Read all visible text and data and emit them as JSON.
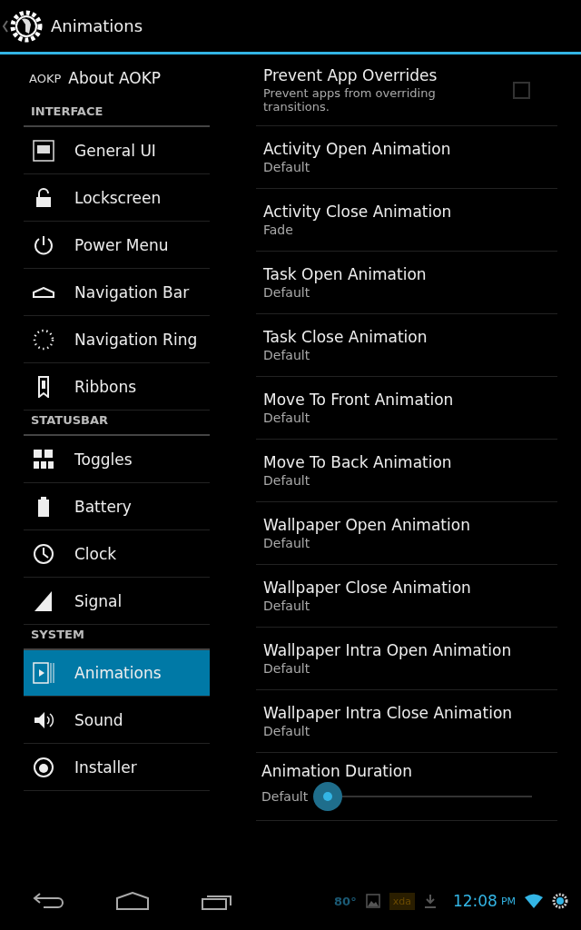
{
  "action_bar": {
    "title": "Animations"
  },
  "sidebar": [
    {
      "kind": "item",
      "logo": "AOKP",
      "label": "About AOKP",
      "selected": false
    },
    {
      "kind": "header",
      "label": "INTERFACE"
    },
    {
      "kind": "item",
      "label": "General UI",
      "selected": false
    },
    {
      "kind": "item",
      "label": "Lockscreen",
      "selected": false
    },
    {
      "kind": "item",
      "label": "Power Menu",
      "selected": false
    },
    {
      "kind": "item",
      "label": "Navigation Bar",
      "selected": false
    },
    {
      "kind": "item",
      "label": "Navigation Ring",
      "selected": false
    },
    {
      "kind": "item",
      "label": "Ribbons",
      "selected": false
    },
    {
      "kind": "header",
      "label": "STATUSBAR"
    },
    {
      "kind": "item",
      "label": "Toggles",
      "selected": false
    },
    {
      "kind": "item",
      "label": "Battery",
      "selected": false
    },
    {
      "kind": "item",
      "label": "Clock",
      "selected": false
    },
    {
      "kind": "item",
      "label": "Signal",
      "selected": false
    },
    {
      "kind": "header",
      "label": "SYSTEM"
    },
    {
      "kind": "item",
      "label": "Animations",
      "selected": true
    },
    {
      "kind": "item",
      "label": "Sound",
      "selected": false
    },
    {
      "kind": "item",
      "label": "Installer",
      "selected": false
    }
  ],
  "settings": [
    {
      "kind": "checkbox",
      "title": "Prevent App Overrides",
      "summary": "Prevent apps from overriding transitions.",
      "checked": false
    },
    {
      "kind": "choice",
      "title": "Activity Open Animation",
      "summary": "Default"
    },
    {
      "kind": "choice",
      "title": "Activity Close Animation",
      "summary": "Fade"
    },
    {
      "kind": "choice",
      "title": "Task Open Animation",
      "summary": "Default"
    },
    {
      "kind": "choice",
      "title": "Task Close Animation",
      "summary": "Default"
    },
    {
      "kind": "choice",
      "title": "Move To Front Animation",
      "summary": "Default"
    },
    {
      "kind": "choice",
      "title": "Move To Back Animation",
      "summary": "Default"
    },
    {
      "kind": "choice",
      "title": "Wallpaper Open Animation",
      "summary": "Default"
    },
    {
      "kind": "choice",
      "title": "Wallpaper Close Animation",
      "summary": "Default"
    },
    {
      "kind": "choice",
      "title": "Wallpaper Intra Open Animation",
      "summary": "Default"
    },
    {
      "kind": "choice",
      "title": "Wallpaper Intra Close Animation",
      "summary": "Default"
    },
    {
      "kind": "slider",
      "title": "Animation Duration",
      "summary": "Default"
    }
  ],
  "system_bar": {
    "temperature": "80°",
    "notification_label": "xda",
    "time": "12:08",
    "meridiem": "PM"
  }
}
